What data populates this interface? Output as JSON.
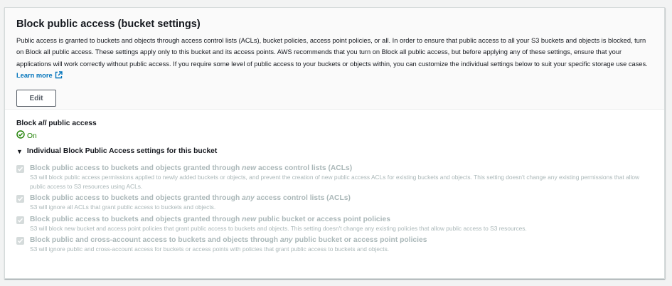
{
  "section": {
    "title": "Block public access (bucket settings)",
    "description": "Public access is granted to buckets and objects through access control lists (ACLs), bucket policies, access point policies, or all. In order to ensure that public access to all your S3 buckets and objects is blocked, turn on Block all public access. These settings apply only to this bucket and its access points. AWS recommends that you turn on Block all public access, but before applying any of these settings, ensure that your applications will work correctly without public access. If you require some level of public access to your buckets or objects within, you can customize the individual settings below to suit your specific storage use cases.",
    "learn_more": "Learn more",
    "edit_label": "Edit"
  },
  "block_all": {
    "prefix": "Block ",
    "emph": "all",
    "suffix": " public access",
    "status": "On"
  },
  "individual": {
    "toggle_label": "Individual Block Public Access settings for this bucket",
    "settings": [
      {
        "title_pre": "Block public access to buckets and objects granted through ",
        "title_em": "new",
        "title_post": " access control lists (ACLs)",
        "desc": "S3 will block public access permissions applied to newly added buckets or objects, and prevent the creation of new public access ACLs for existing buckets and objects. This setting doesn't change any existing permissions that allow public access to S3 resources using ACLs.",
        "checked": true
      },
      {
        "title_pre": "Block public access to buckets and objects granted through ",
        "title_em": "any",
        "title_post": " access control lists (ACLs)",
        "desc": "S3 will ignore all ACLs that grant public access to buckets and objects.",
        "checked": true
      },
      {
        "title_pre": "Block public access to buckets and objects granted through ",
        "title_em": "new",
        "title_post": " public bucket or access point policies",
        "desc": "S3 will block new bucket and access point policies that grant public access to buckets and objects. This setting doesn't change any existing policies that allow public access to S3 resources.",
        "checked": true
      },
      {
        "title_pre": "Block public and cross-account access to buckets and objects through ",
        "title_em": "any",
        "title_post": " public bucket or access point policies",
        "desc": "S3 will ignore public and cross-account access for buckets or access points with policies that grant public access to buckets and objects.",
        "checked": true
      }
    ]
  },
  "colors": {
    "link": "#0073bb",
    "success": "#1d8102",
    "disabled_text": "#aab7b8"
  },
  "icons": {
    "external": "external-link-icon",
    "status": "check-circle-icon",
    "caret": "caret-down-icon",
    "checkbox": "checkmark-icon"
  }
}
